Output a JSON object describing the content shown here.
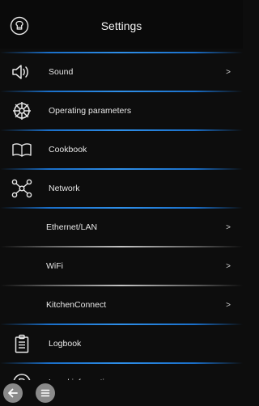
{
  "header": {
    "title": "Settings",
    "icon": "chef-hat-icon"
  },
  "items": [
    {
      "key": "sound",
      "label": "Sound",
      "icon": "speaker-icon",
      "chevron": ">"
    },
    {
      "key": "operating",
      "label": "Operating parameters",
      "icon": "wheel-icon",
      "chevron": ""
    },
    {
      "key": "cookbook",
      "label": "Cookbook",
      "icon": "book-icon",
      "chevron": ""
    },
    {
      "key": "network",
      "label": "Network",
      "icon": "network-icon",
      "chevron": ""
    },
    {
      "key": "ethernet",
      "label": "Ethernet/LAN",
      "icon": "",
      "chevron": ">"
    },
    {
      "key": "wifi",
      "label": "WiFi",
      "icon": "",
      "chevron": ">"
    },
    {
      "key": "kitchenconnect",
      "label": "KitchenConnect",
      "icon": "",
      "chevron": ">"
    },
    {
      "key": "logbook",
      "label": "Logbook",
      "icon": "clipboard-icon",
      "chevron": ""
    },
    {
      "key": "legal",
      "label": "Legal information",
      "icon": "legal-icon",
      "chevron": ""
    }
  ],
  "footer": {
    "back_icon": "back-arrow-icon",
    "menu_icon": "menu-icon"
  },
  "colors": {
    "accent": "#2f8fe8",
    "background": "#0d0d0d",
    "button": "#8a8a8a"
  }
}
